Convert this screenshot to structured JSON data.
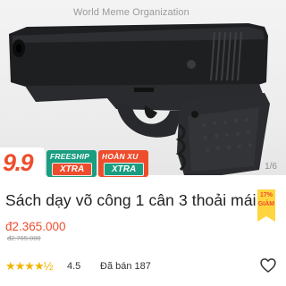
{
  "watermark": "World Meme Organization",
  "image": {
    "icon": "pistol-image",
    "page_indicator": "1/6"
  },
  "promo": {
    "campaign_label": "9.9",
    "freeship": {
      "top": "FREESHIP",
      "bottom": "XTRA"
    },
    "coin": {
      "top": "HOÀN XU",
      "bottom": "XTRA"
    }
  },
  "product": {
    "title": "Sách dạy võ công 1 cân 3 thoải mái",
    "discount_line1": "17%",
    "discount_line2": "GIẢM",
    "price": "đ2.365.000",
    "old_price": "đ2.765.000",
    "rating_stars": "★★★★½",
    "rating": "4.5",
    "sold": "Đã bán 187"
  },
  "colors": {
    "accent": "#ee4d2d",
    "green": "#1a9d80",
    "star": "#f3b400"
  },
  "icons": {
    "favorite": "heart-outline-icon"
  }
}
